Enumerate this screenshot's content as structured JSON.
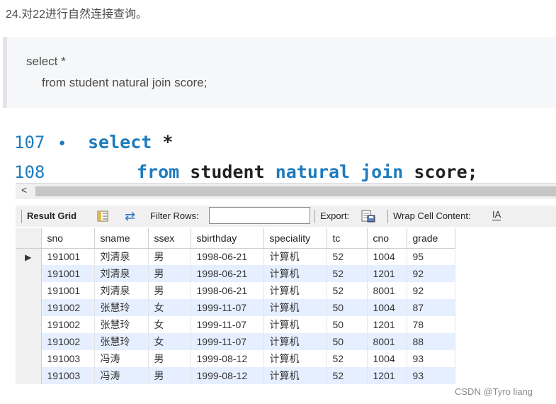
{
  "heading": "24.对22进行自然连接查询。",
  "code_block": {
    "line1": "select *",
    "line2": "from student natural join score;"
  },
  "editor": {
    "line_numbers": [
      "107",
      "108"
    ],
    "line1": {
      "kw": "select",
      "rest": " *"
    },
    "line2": {
      "kw1": "from",
      "t1": " student ",
      "kw2": "natural",
      "t2": " ",
      "kw3": "join",
      "t3": " score;"
    }
  },
  "scrollbar": {
    "left_arrow": "<"
  },
  "toolbar": {
    "result_grid_label": "Result Grid",
    "filter_label": "Filter Rows:",
    "filter_value": "",
    "export_label": "Export:",
    "wrap_label": "Wrap Cell Content:",
    "wrap_icon_text": "IA"
  },
  "grid": {
    "columns": [
      "sno",
      "sname",
      "ssex",
      "sbirthday",
      "speciality",
      "tc",
      "cno",
      "grade"
    ],
    "rows": [
      [
        "191001",
        "刘清泉",
        "男",
        "1998-06-21",
        "计算机",
        "52",
        "1004",
        "95"
      ],
      [
        "191001",
        "刘清泉",
        "男",
        "1998-06-21",
        "计算机",
        "52",
        "1201",
        "92"
      ],
      [
        "191001",
        "刘清泉",
        "男",
        "1998-06-21",
        "计算机",
        "52",
        "8001",
        "92"
      ],
      [
        "191002",
        "张慧玲",
        "女",
        "1999-11-07",
        "计算机",
        "50",
        "1004",
        "87"
      ],
      [
        "191002",
        "张慧玲",
        "女",
        "1999-11-07",
        "计算机",
        "50",
        "1201",
        "78"
      ],
      [
        "191002",
        "张慧玲",
        "女",
        "1999-11-07",
        "计算机",
        "50",
        "8001",
        "88"
      ],
      [
        "191003",
        "冯涛",
        "男",
        "1999-08-12",
        "计算机",
        "52",
        "1004",
        "93"
      ],
      [
        "191003",
        "冯涛",
        "男",
        "1999-08-12",
        "计算机",
        "52",
        "1201",
        "93"
      ]
    ]
  },
  "watermark": "CSDN @Tyro liang",
  "colors": {
    "keyword": "#1c7bbf",
    "row_stripe": "#e6efff",
    "toolbar_bg": "#f0f0f0"
  }
}
